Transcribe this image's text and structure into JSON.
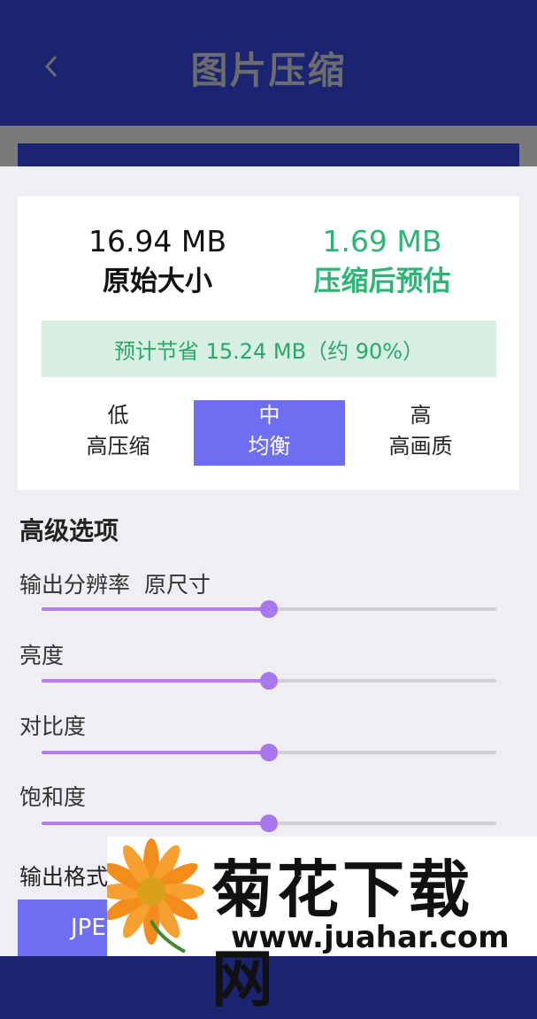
{
  "header": {
    "title": "图片压缩",
    "back_icon": "chevron-left-icon"
  },
  "summary": {
    "original_size": "16.94 MB",
    "original_label": "原始大小",
    "compressed_size": "1.69 MB",
    "compressed_label": "压缩后预估",
    "savings_text": "预计节省 15.24 MB（约 90%）",
    "accent_green": "#2fb477"
  },
  "quality_options": [
    {
      "level": "低",
      "desc": "高压缩",
      "selected": false
    },
    {
      "level": "中",
      "desc": "均衡",
      "selected": true
    },
    {
      "level": "高",
      "desc": "高画质",
      "selected": false
    }
  ],
  "advanced": {
    "title": "高级选项",
    "sliders": [
      {
        "label": "输出分辨率",
        "value_text": "原尺寸",
        "value": 0.5
      },
      {
        "label": "亮度",
        "value_text": "",
        "value": 0.5
      },
      {
        "label": "对比度",
        "value_text": "",
        "value": 0.5
      },
      {
        "label": "饱和度",
        "value_text": "",
        "value": 0.5
      }
    ]
  },
  "output_format": {
    "label": "输出格式",
    "selected": "JPE"
  },
  "watermark": {
    "title": "菊花下载网",
    "url": "www.juahar.com"
  },
  "colors": {
    "primary": "#6e6ef2",
    "slider": "#b27ef0",
    "header": "#1b2470"
  }
}
